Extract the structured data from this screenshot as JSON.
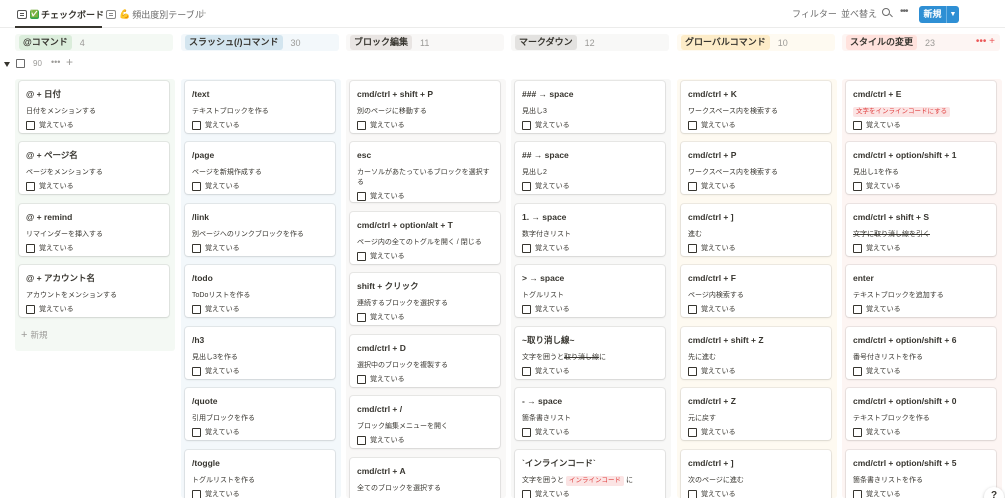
{
  "tabs": [
    {
      "label": "チェックボード",
      "prefix": "✅"
    },
    {
      "label": "頻出度別テーブル",
      "prefix": "💪"
    }
  ],
  "toolbar": {
    "filter": "フィルター",
    "sort": "並べ替え",
    "new": "新規"
  },
  "group": {
    "count": "90"
  },
  "add_card_label": "新規",
  "checkbox_label": "覚えている",
  "colors": {
    "accent": "#2e8fd4",
    "card_bg": "#ffffff"
  },
  "columns": [
    {
      "name": "@コマンド",
      "count": "4",
      "pill_color": "#dbeddb",
      "head_bg": "#f4f9f4",
      "bg": "#f4f9f4",
      "cards": [
        {
          "title": "@ + 日付",
          "desc": "日付をメンションする"
        },
        {
          "title": "@ + ページ名",
          "desc": "ページをメンションする"
        },
        {
          "title": "@ + remind",
          "desc": "リマインダーを挿入する"
        },
        {
          "title": "@ + アカウント名",
          "desc": "アカウントをメンションする"
        }
      ]
    },
    {
      "name": "スラッシュ(/)コマンド",
      "count": "30",
      "pill_color": "#d3e5ef",
      "head_bg": "#f3f8fb",
      "bg": "#f3f8fb",
      "cards": [
        {
          "title": "/text",
          "desc": "テキストブロックを作る"
        },
        {
          "title": "/page",
          "desc": "ページを新規作成する"
        },
        {
          "title": "/link",
          "desc": "別ページへのリンクブロックを作る"
        },
        {
          "title": "/todo",
          "desc": "ToDoリストを作る"
        },
        {
          "title": "/h3",
          "desc": "見出し3を作る"
        },
        {
          "title": "/quote",
          "desc": "引用ブロックを作る"
        },
        {
          "title": "/toggle",
          "desc": "トグルリストを作る"
        }
      ]
    },
    {
      "name": "ブロック編集",
      "count": "11",
      "pill_color": "#e9e5e3",
      "head_bg": "#f9f8f7",
      "bg": "#f9f8f7",
      "cards": [
        {
          "title": "cmd/ctrl + shift + P",
          "desc": "別のページに移動する"
        },
        {
          "title": "esc",
          "desc": "カーソルがあたっているブロックを選択する"
        },
        {
          "title": "cmd/ctrl + option/alt + T",
          "desc": "ページ内の全てのトグルを開く / 閉じる"
        },
        {
          "title": "shift + クリック",
          "desc": "連続するブロックを選択する"
        },
        {
          "title": "cmd/ctrl + D",
          "desc": "選択中のブロックを複製する"
        },
        {
          "title": "cmd/ctrl + /",
          "desc": "ブロック編集メニューを開く"
        },
        {
          "title": "cmd/ctrl + A",
          "desc": "全てのブロックを選択する"
        }
      ]
    },
    {
      "name": "マークダウン",
      "count": "12",
      "pill_color": "#e3e2e0",
      "head_bg": "#f8f8f7",
      "bg": "#f8f8f7",
      "cards": [
        {
          "title": "### → space",
          "desc": "見出し3"
        },
        {
          "title": "## → space",
          "desc": "見出し2"
        },
        {
          "title": "1. → space",
          "desc": "数字付きリスト"
        },
        {
          "title": "> → space",
          "desc": "トグルリスト"
        },
        {
          "title": "~取り消し線~",
          "desc": "文字を囲うと",
          "desc_strike": "取り消し線",
          "desc_tail": "に"
        },
        {
          "title": "- → space",
          "desc": "箇条書きリスト"
        },
        {
          "title": "`インラインコード`",
          "desc": "文字を囲うと",
          "desc_code": "インラインコード",
          "desc_tail": "に"
        }
      ]
    },
    {
      "name": "グローバルコマンド",
      "count": "10",
      "pill_color": "#fdecc8",
      "head_bg": "#fefaf1",
      "bg": "#fefaf1",
      "cards": [
        {
          "title": "cmd/ctrl + K",
          "desc": "ワークスペース内を検索する"
        },
        {
          "title": "cmd/ctrl + P",
          "desc": "ワークスペース内を検索する"
        },
        {
          "title": "cmd/ctrl + ]",
          "desc": "進む"
        },
        {
          "title": "cmd/ctrl + F",
          "desc": "ページ内検索する"
        },
        {
          "title": "cmd/ctrl + shift + Z",
          "desc": "先に進む"
        },
        {
          "title": "cmd/ctrl + Z",
          "desc": "元に戻す"
        },
        {
          "title": "cmd/ctrl + ]",
          "desc": "次のページに進む"
        }
      ]
    },
    {
      "name": "スタイルの変更",
      "count": "23",
      "pill_color": "#ffe2dd",
      "head_bg": "#fdf5f3",
      "bg": "#fdf5f3",
      "cards": [
        {
          "title": "cmd/ctrl + E",
          "desc_code": "文字をインラインコードにする"
        },
        {
          "title": "cmd/ctrl + option/shift + 1",
          "desc": "見出し1を作る"
        },
        {
          "title": "cmd/ctrl + shift + S",
          "desc_strike": "文字に取り消し線を引く"
        },
        {
          "title": "enter",
          "desc": "テキストブロックを追加する"
        },
        {
          "title": "cmd/ctrl + option/shift + 6",
          "desc": "番号付きリストを作る"
        },
        {
          "title": "cmd/ctrl + option/shift + 0",
          "desc": "テキストブロックを作る"
        },
        {
          "title": "cmd/ctrl + option/shift + 5",
          "desc": "箇条書きリストを作る"
        }
      ]
    }
  ]
}
